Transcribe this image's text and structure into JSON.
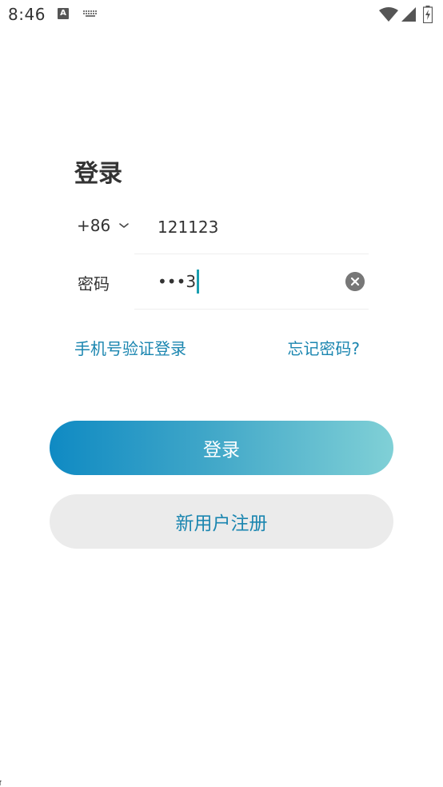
{
  "status_bar": {
    "time": "8:46",
    "a_icon_letter": "A",
    "icons": [
      "a-notification-icon",
      "keyboard-icon",
      "wifi-icon",
      "signal-icon",
      "battery-icon"
    ]
  },
  "login": {
    "title": "登录",
    "country_code": "+86",
    "phone_value": "121123",
    "password_label": "密码",
    "password_masked": "•••3",
    "sms_login_link": "手机号验证登录",
    "forgot_password_link": "忘记密码?",
    "login_button": "登录",
    "register_button": "新用户注册"
  },
  "colors": {
    "accent": "#1b86b0",
    "gradient_start": "#0f8ac3",
    "gradient_end": "#80d0d6",
    "secondary_button_bg": "#ebebeb",
    "text": "#333333",
    "cursor": "#1a9fb0"
  }
}
